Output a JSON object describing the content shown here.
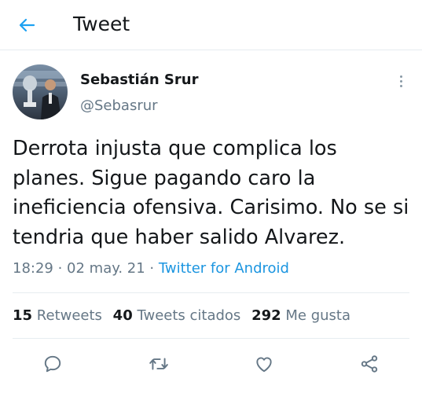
{
  "header": {
    "title": "Tweet",
    "back_icon": "arrow-left-icon",
    "accent": "#1da1f2"
  },
  "author": {
    "name": "Sebastián Srur",
    "handle": "@Sebasrur"
  },
  "tweet": {
    "text": "Derrota injusta que complica los planes. Sigue pagando caro la ineficiencia ofensiva. Carisimo. No se si tendria que haber salido Alvarez.",
    "time": "18:29",
    "separator1": " · ",
    "date": "02 may. 21",
    "separator2": " · ",
    "source": "Twitter for Android"
  },
  "stats": {
    "retweets_count": "15",
    "retweets_label": "Retweets",
    "quotes_count": "40",
    "quotes_label": "Tweets citados",
    "likes_count": "292",
    "likes_label": "Me gusta"
  },
  "actions": [
    "reply-icon",
    "retweet-icon",
    "like-icon",
    "share-icon"
  ],
  "colors": {
    "text": "#14171a",
    "secondary": "#657786",
    "link": "#1b95e0",
    "divider": "#e6ecf0",
    "icon": "#657786"
  }
}
